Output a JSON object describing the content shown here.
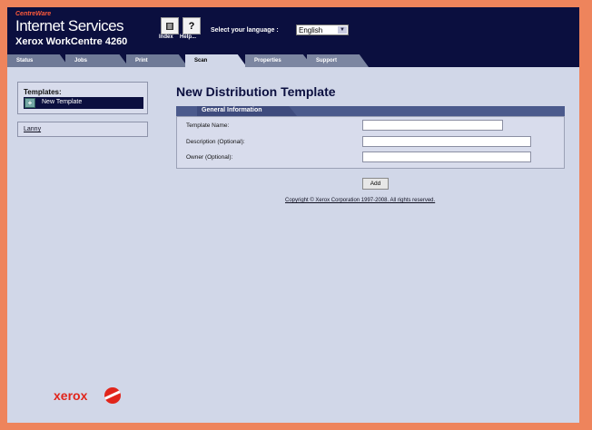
{
  "header": {
    "brand_small": "CentreWare",
    "brand_title": "Internet Services",
    "brand_sub": "Xerox WorkCentre 4260",
    "index_label": "Index",
    "help_label": "Help...",
    "index_icon": "index-book-icon",
    "help_icon": "help-question-icon",
    "language_label": "Select your language :",
    "language_value": "English"
  },
  "tabs": [
    "Status",
    "Jobs",
    "Print",
    "Scan",
    "Properties",
    "Support"
  ],
  "active_tab": "Scan",
  "sidebar": {
    "templates_title": "Templates:",
    "selected_item": "New Template",
    "lanny_link": "Lanny"
  },
  "main": {
    "title": "New Distribution Template",
    "section_title": "General Information",
    "fields": [
      {
        "label": "Template Name:",
        "value": ""
      },
      {
        "label": "Description (Optional):",
        "value": ""
      },
      {
        "label": "Owner (Optional):",
        "value": ""
      }
    ],
    "add_button": "Add",
    "copyright": "Copyright © Xerox Corporation 1997-2008. All rights reserved."
  },
  "footer": {
    "logo_text": "xerox"
  },
  "colors": {
    "background_border": "#ee845c",
    "header": "#0b0f3f",
    "page": "#d1d7e8",
    "section_bar": "#4b5a8c",
    "logo_red": "#e1251b"
  }
}
